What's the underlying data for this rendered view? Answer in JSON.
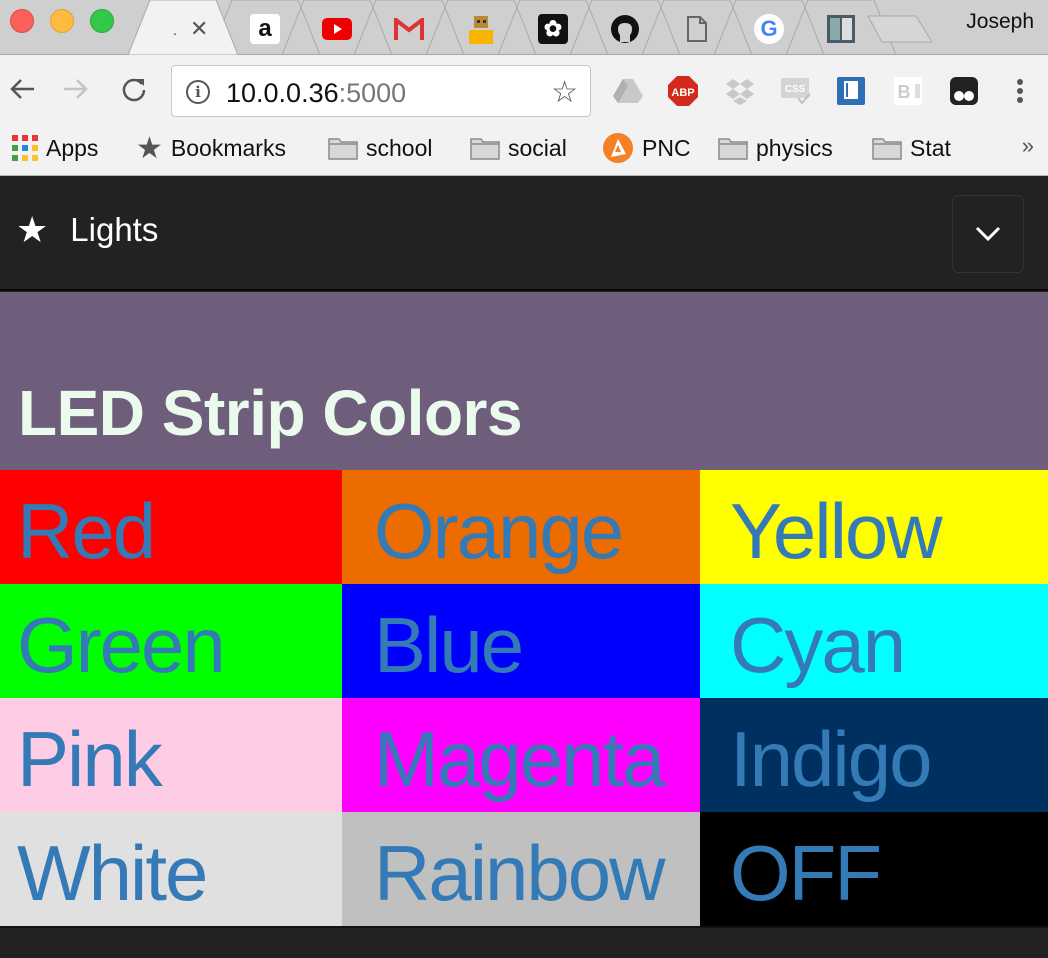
{
  "browser": {
    "profile_name": "Joseph",
    "active_tab": {
      "title": ".",
      "favicon": "none"
    },
    "tabs": [
      {
        "favicon": "amazon-icon"
      },
      {
        "favicon": "youtube-icon"
      },
      {
        "favicon": "gmail-icon"
      },
      {
        "favicon": "robot-icon"
      },
      {
        "favicon": "adafruit-icon"
      },
      {
        "favicon": "github-icon"
      },
      {
        "favicon": "blank-page-icon"
      },
      {
        "favicon": "google-icon"
      },
      {
        "favicon": "sheets-icon"
      }
    ],
    "address": {
      "host": "10.0.0.36",
      "port": ":5000"
    },
    "extensions": [
      "google-drive-icon",
      "adblock-plus-icon",
      "dropbox-icon",
      "css-validator-icon",
      "bookmark-manager-icon",
      "screen-recorder-icon",
      "tampermonkey-icon"
    ],
    "bookmarks": [
      {
        "label": "Apps",
        "icon": "apps-grid-icon"
      },
      {
        "label": "Bookmarks",
        "icon": "star-icon"
      },
      {
        "label": "school",
        "icon": "folder-icon"
      },
      {
        "label": "social",
        "icon": "folder-icon"
      },
      {
        "label": "PNC",
        "icon": "pnc-icon"
      },
      {
        "label": "physics",
        "icon": "folder-icon"
      },
      {
        "label": "Stat",
        "icon": "folder-icon"
      }
    ],
    "bookmarks_overflow": "»"
  },
  "app": {
    "navbar": {
      "brand_icon": "★",
      "brand_title": "Lights",
      "toggle_icon": "chevron-down-icon"
    },
    "heading": "LED Strip Colors",
    "text_color": "#337ab7",
    "colors": [
      {
        "label": "Red",
        "bg": "#ff0000"
      },
      {
        "label": "Orange",
        "bg": "#ec6c00"
      },
      {
        "label": "Yellow",
        "bg": "#ffff00"
      },
      {
        "label": "Green",
        "bg": "#00ff00"
      },
      {
        "label": "Blue",
        "bg": "#0000ff"
      },
      {
        "label": "Cyan",
        "bg": "#00ffff"
      },
      {
        "label": "Pink",
        "bg": "#ffccE5"
      },
      {
        "label": "Magenta",
        "bg": "#ff00ff"
      },
      {
        "label": "Indigo",
        "bg": "#003060"
      },
      {
        "label": "White",
        "bg": "#e0e0e0"
      },
      {
        "label": "Rainbow",
        "bg": "#c0c0c0"
      },
      {
        "label": "OFF",
        "bg": "#000000"
      }
    ]
  }
}
